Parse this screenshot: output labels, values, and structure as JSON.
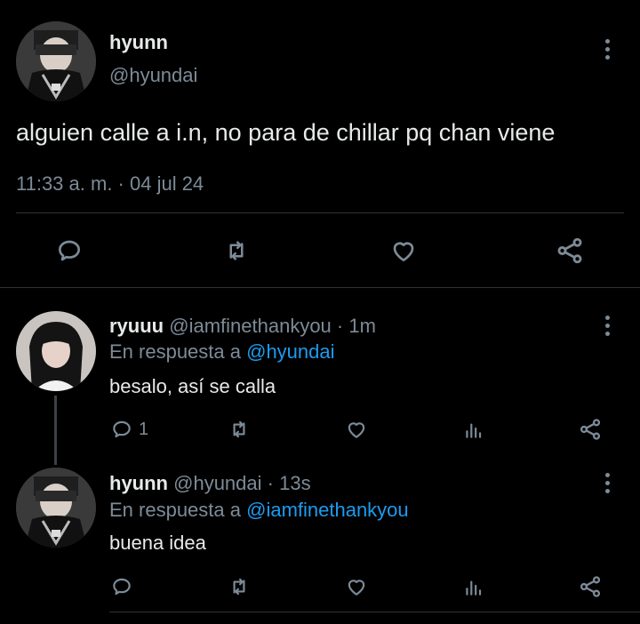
{
  "main_tweet": {
    "display_name": "hyunn",
    "handle": "@hyundai",
    "text": "alguien calle a i.n, no para de chillar pq chan viene",
    "timestamp": "11:33 a. m. · 04 jul 24"
  },
  "replies": [
    {
      "display_name": "ryuuu",
      "handle": "@iamfinethankyou",
      "time": "· 1m",
      "reply_prefix": "En respuesta a",
      "reply_to": "@hyundai",
      "text": "besalo, así se calla",
      "reply_count": "1"
    },
    {
      "display_name": "hyunn",
      "handle": "@hyundai",
      "time": "· 13s",
      "reply_prefix": "En respuesta a",
      "reply_to": "@iamfinethankyou",
      "text": "buena idea",
      "reply_count": ""
    }
  ],
  "icons": [
    "reply-icon",
    "retweet-icon",
    "like-icon",
    "analytics-icon",
    "share-icon",
    "more-options-icon"
  ],
  "colors": {
    "background": "#000000",
    "text": "#e7e9ea",
    "muted": "#7d8b98",
    "link": "#1d9bf0",
    "divider": "#2f3336"
  }
}
